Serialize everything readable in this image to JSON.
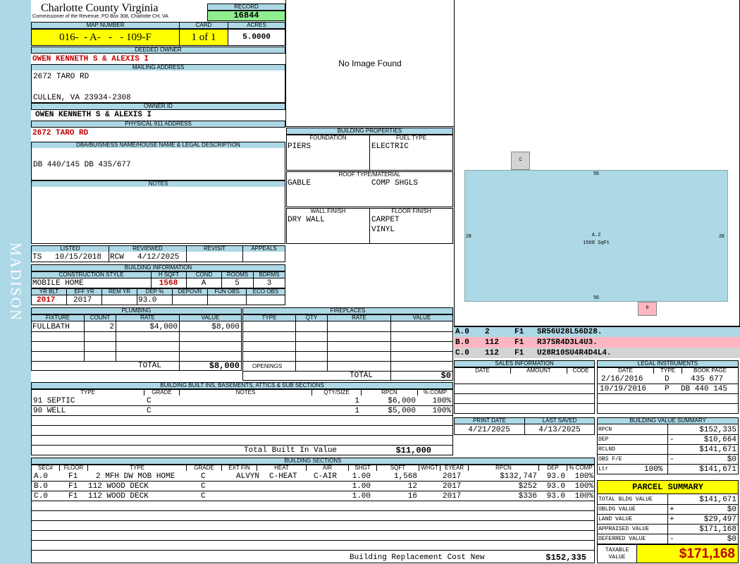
{
  "header": {
    "county": "Charlotte County Virginia",
    "commissioner": "Commissioner of the Revenue, PO Box 308, Charlotte CH, VA",
    "record_label": "RECORD",
    "record": "16844",
    "map_number_label": "MAP NUMBER",
    "map_number": "016-  - A-   -   - 109-F",
    "card_label": "CARD",
    "card": "1 of 1",
    "acres_label": "ACRES",
    "acres": "5.0000"
  },
  "sidebar": {
    "district": "MADISON"
  },
  "owner": {
    "deeded_label": "DEEDED OWNER",
    "deeded": "OWEN KENNETH S & ALEXIS I",
    "mailing_label": "MAILING ADDRESS",
    "mailing_line1": "2672 TARO RD",
    "mailing_line2": "CULLEN, VA 23934-2308",
    "owner_id_label": "OWNER ID",
    "owner_id": "OWEN KENNETH S & ALEXIS I",
    "physical_label": "PHYSICAL 911 ADDRESS",
    "physical": "2672 TARO RD"
  },
  "legal": {
    "label": "DBA/BUISNESS NAME/HOUSE NAME & LEGAL DESCRIPTION",
    "text": "DB 440/145 DB 435/677"
  },
  "notes": {
    "label": "NOTES"
  },
  "image": {
    "text": "No Image Found"
  },
  "listing": {
    "listed_label": "LISTED",
    "reviewed_label": "REVIEWED",
    "revisit_label": "REVISIT",
    "appeals_label": "APPEALS",
    "listed_by": "TS",
    "listed_date": "10/15/2018",
    "reviewed_by": "RCW",
    "reviewed_date": "4/12/2025"
  },
  "building_info": {
    "label": "BUILDING INFORMATION",
    "construction_label": "CONSTRUCTION STYLE",
    "hsqft_label": "H SQFT",
    "cond_label": "COND",
    "rooms_label": "ROOMS",
    "bdrms_label": "BDRMS",
    "construction": "MOBILE HOME",
    "hsqft": "1568",
    "cond": "A",
    "rooms": "5",
    "bdrms": "3",
    "yrblt_label": "YR BLT",
    "effyr_label": "EFF YR",
    "remyr_label": "REM YR",
    "dep_label": "DEP %",
    "depovr_label": "DEPOVR",
    "funobs_label": "FUN OBS",
    "ecoobs_label": "ECO OBS",
    "yrblt": "2017",
    "effyr": "2017",
    "dep": "93.0"
  },
  "plumbing": {
    "label": "PLUMBING",
    "fixture_label": "FIXTURE",
    "count_label": "COUNT",
    "rate_label": "RATE",
    "value_label": "VALUE",
    "rows": [
      {
        "fixture": "FULLBATH",
        "count": "2",
        "rate": "$4,000",
        "value": "$8,000"
      }
    ],
    "total_label": "TOTAL",
    "total": "$8,000"
  },
  "fireplaces": {
    "label": "FIREPLACES",
    "type_label": "TYPE",
    "qty_label": "QTY",
    "rate_label": "RATE",
    "value_label": "VALUE",
    "openings_label": "OPENINGS",
    "total_label": "TOTAL",
    "total": "$0"
  },
  "building_properties": {
    "label": "BUILDING PROPERTIES",
    "foundation_label": "FOUNDATION",
    "fuel_label": "FUEL TYPE",
    "foundation": "PIERS",
    "fuel": "ELECTRIC",
    "roof_label": "ROOF TYPE/MATERIAL",
    "roof_type": "GABLE",
    "roof_material": "COMP SHGLS",
    "wall_label": "WALL FINISH",
    "floor_label": "FLOOR FINISH",
    "wall": "DRY WALL",
    "floor1": "CARPET",
    "floor2": "VINYL"
  },
  "sketch": {
    "main_label": "A.2",
    "main_area": "1568 SqFt",
    "dim_top": "56",
    "dim_bottom": "56",
    "dim_left": "28",
    "dim_right": "28",
    "box_c": "C",
    "box_b": "B"
  },
  "sketch_codes": [
    {
      "sec": "A.0",
      "code1": "2",
      "floor": "F1",
      "path": "SR56U28L56D28."
    },
    {
      "sec": "B.0",
      "code1": "112",
      "floor": "F1",
      "path": "R37SR4D3L4U3."
    },
    {
      "sec": "C.0",
      "code1": "112",
      "floor": "F1",
      "path": "U28R10SU4R4D4L4."
    }
  ],
  "sales": {
    "label": "SALES INFORMATION",
    "date_label": "DATE",
    "amount_label": "AMOUNT",
    "code_label": "CODE"
  },
  "legal_instruments": {
    "label": "LEGAL INSTRUMENTS",
    "date_label": "DATE",
    "type_label": "TYPE",
    "bookpage_label": "BOOK PAGE",
    "rows": [
      {
        "date": "2/16/2016",
        "type": "D",
        "bookpage": "435 677"
      },
      {
        "date": "10/19/2016",
        "type": "P",
        "bookpage": "DB 440 145"
      }
    ]
  },
  "dates": {
    "print_label": "PRINT DATE",
    "saved_label": "LAST SAVED",
    "print": "4/21/2025",
    "saved": "4/13/2025"
  },
  "built_ins": {
    "label": "BUILDING BUILT INS, BASEMENTS, ATTICS & SUB SECTIONS",
    "type_label": "TYPE",
    "grade_label": "GRADE",
    "notes_label": "NOTES",
    "qty_label": "QTY/SIZE",
    "rpcn_label": "RPCN",
    "comp_label": "% COMP",
    "rows": [
      {
        "type": "91 SEPTIC",
        "grade": "C",
        "qty": "1",
        "rpcn": "$6,000",
        "comp": "100%"
      },
      {
        "type": "90 WELL",
        "grade": "C",
        "qty": "1",
        "rpcn": "$5,000",
        "comp": "100%"
      }
    ],
    "total_label": "Total Built In Value",
    "total": "$11,000"
  },
  "building_value_summary": {
    "label": "BUILDING VALUE SUMMARY",
    "rpcn_label": "RPCN",
    "rpcn": "$152,335",
    "dep_label": "DEP",
    "dep_sign": "-",
    "dep": "$10,664",
    "rclnd_label": "RCLND",
    "rclnd": "$141,671",
    "obs_label": "OBS F/E",
    "obs_sign": "-",
    "obs": "$0",
    "ltr_label": "Ltr",
    "ltr_pct": "100%",
    "ltr": "$141,671"
  },
  "sections": {
    "label": "BUILDING SECTIONS",
    "sec_label": "SEC#",
    "floor_label": "FLOOR",
    "type_label": "TYPE",
    "grade_label": "GRADE",
    "extfin_label": "EXT FIN",
    "heat_label": "HEAT",
    "air_label": "AIR",
    "shgt_label": "SHGT",
    "sqft_label": "SQFT",
    "whgt_label": "WHGT",
    "eyear_label": "EYEAR",
    "rpcn_label": "RPCN",
    "dep_label": "DEP",
    "comp_label": "% COMP",
    "rows": [
      {
        "sec": "A.0",
        "floor": "F1",
        "type": "2 MFH DW MOB HOME",
        "grade": "C",
        "extfin": "ALVYN",
        "heat": "C-HEAT",
        "air": "C-AIR",
        "shgt": "1.00",
        "sqft": "1,568",
        "eyear": "2017",
        "rpcn": "$132,747",
        "dep": "93.0",
        "comp": "100%"
      },
      {
        "sec": "B.0",
        "floor": "F1",
        "type": "112 WOOD DECK",
        "grade": "C",
        "extfin": "",
        "heat": "",
        "air": "",
        "shgt": "1.00",
        "sqft": "12",
        "eyear": "2017",
        "rpcn": "$252",
        "dep": "93.0",
        "comp": "100%"
      },
      {
        "sec": "C.0",
        "floor": "F1",
        "type": "112 WOOD DECK",
        "grade": "C",
        "extfin": "",
        "heat": "",
        "air": "",
        "shgt": "1.00",
        "sqft": "16",
        "eyear": "2017",
        "rpcn": "$336",
        "dep": "93.0",
        "comp": "100%"
      }
    ],
    "replacement_label": "Building Replacement Cost New",
    "replacement": "$152,335"
  },
  "parcel_summary": {
    "label": "PARCEL SUMMARY",
    "total_bldg_label": "TOTAL BLDG VALUE",
    "total_bldg": "$141,671",
    "obldg_label": "OBLDG VALUE",
    "obldg_sign": "+",
    "obldg": "$0",
    "land_label": "LAND VALUE",
    "land_sign": "+",
    "land": "$29,497",
    "appraised_label": "APPRAISED VALUE",
    "appraised": "$171,168",
    "deferred_label": "DEFERRED VALUE",
    "deferred_sign": "-",
    "deferred": "$0",
    "taxable_label1": "TAXABLE",
    "taxable_label2": "VALUE",
    "taxable": "$171,168"
  },
  "colors": {
    "header_blue": "#add8e6",
    "yellow": "#ffff00",
    "green": "#90ee90",
    "pink": "#ffb6c1",
    "red": "#c00000"
  }
}
